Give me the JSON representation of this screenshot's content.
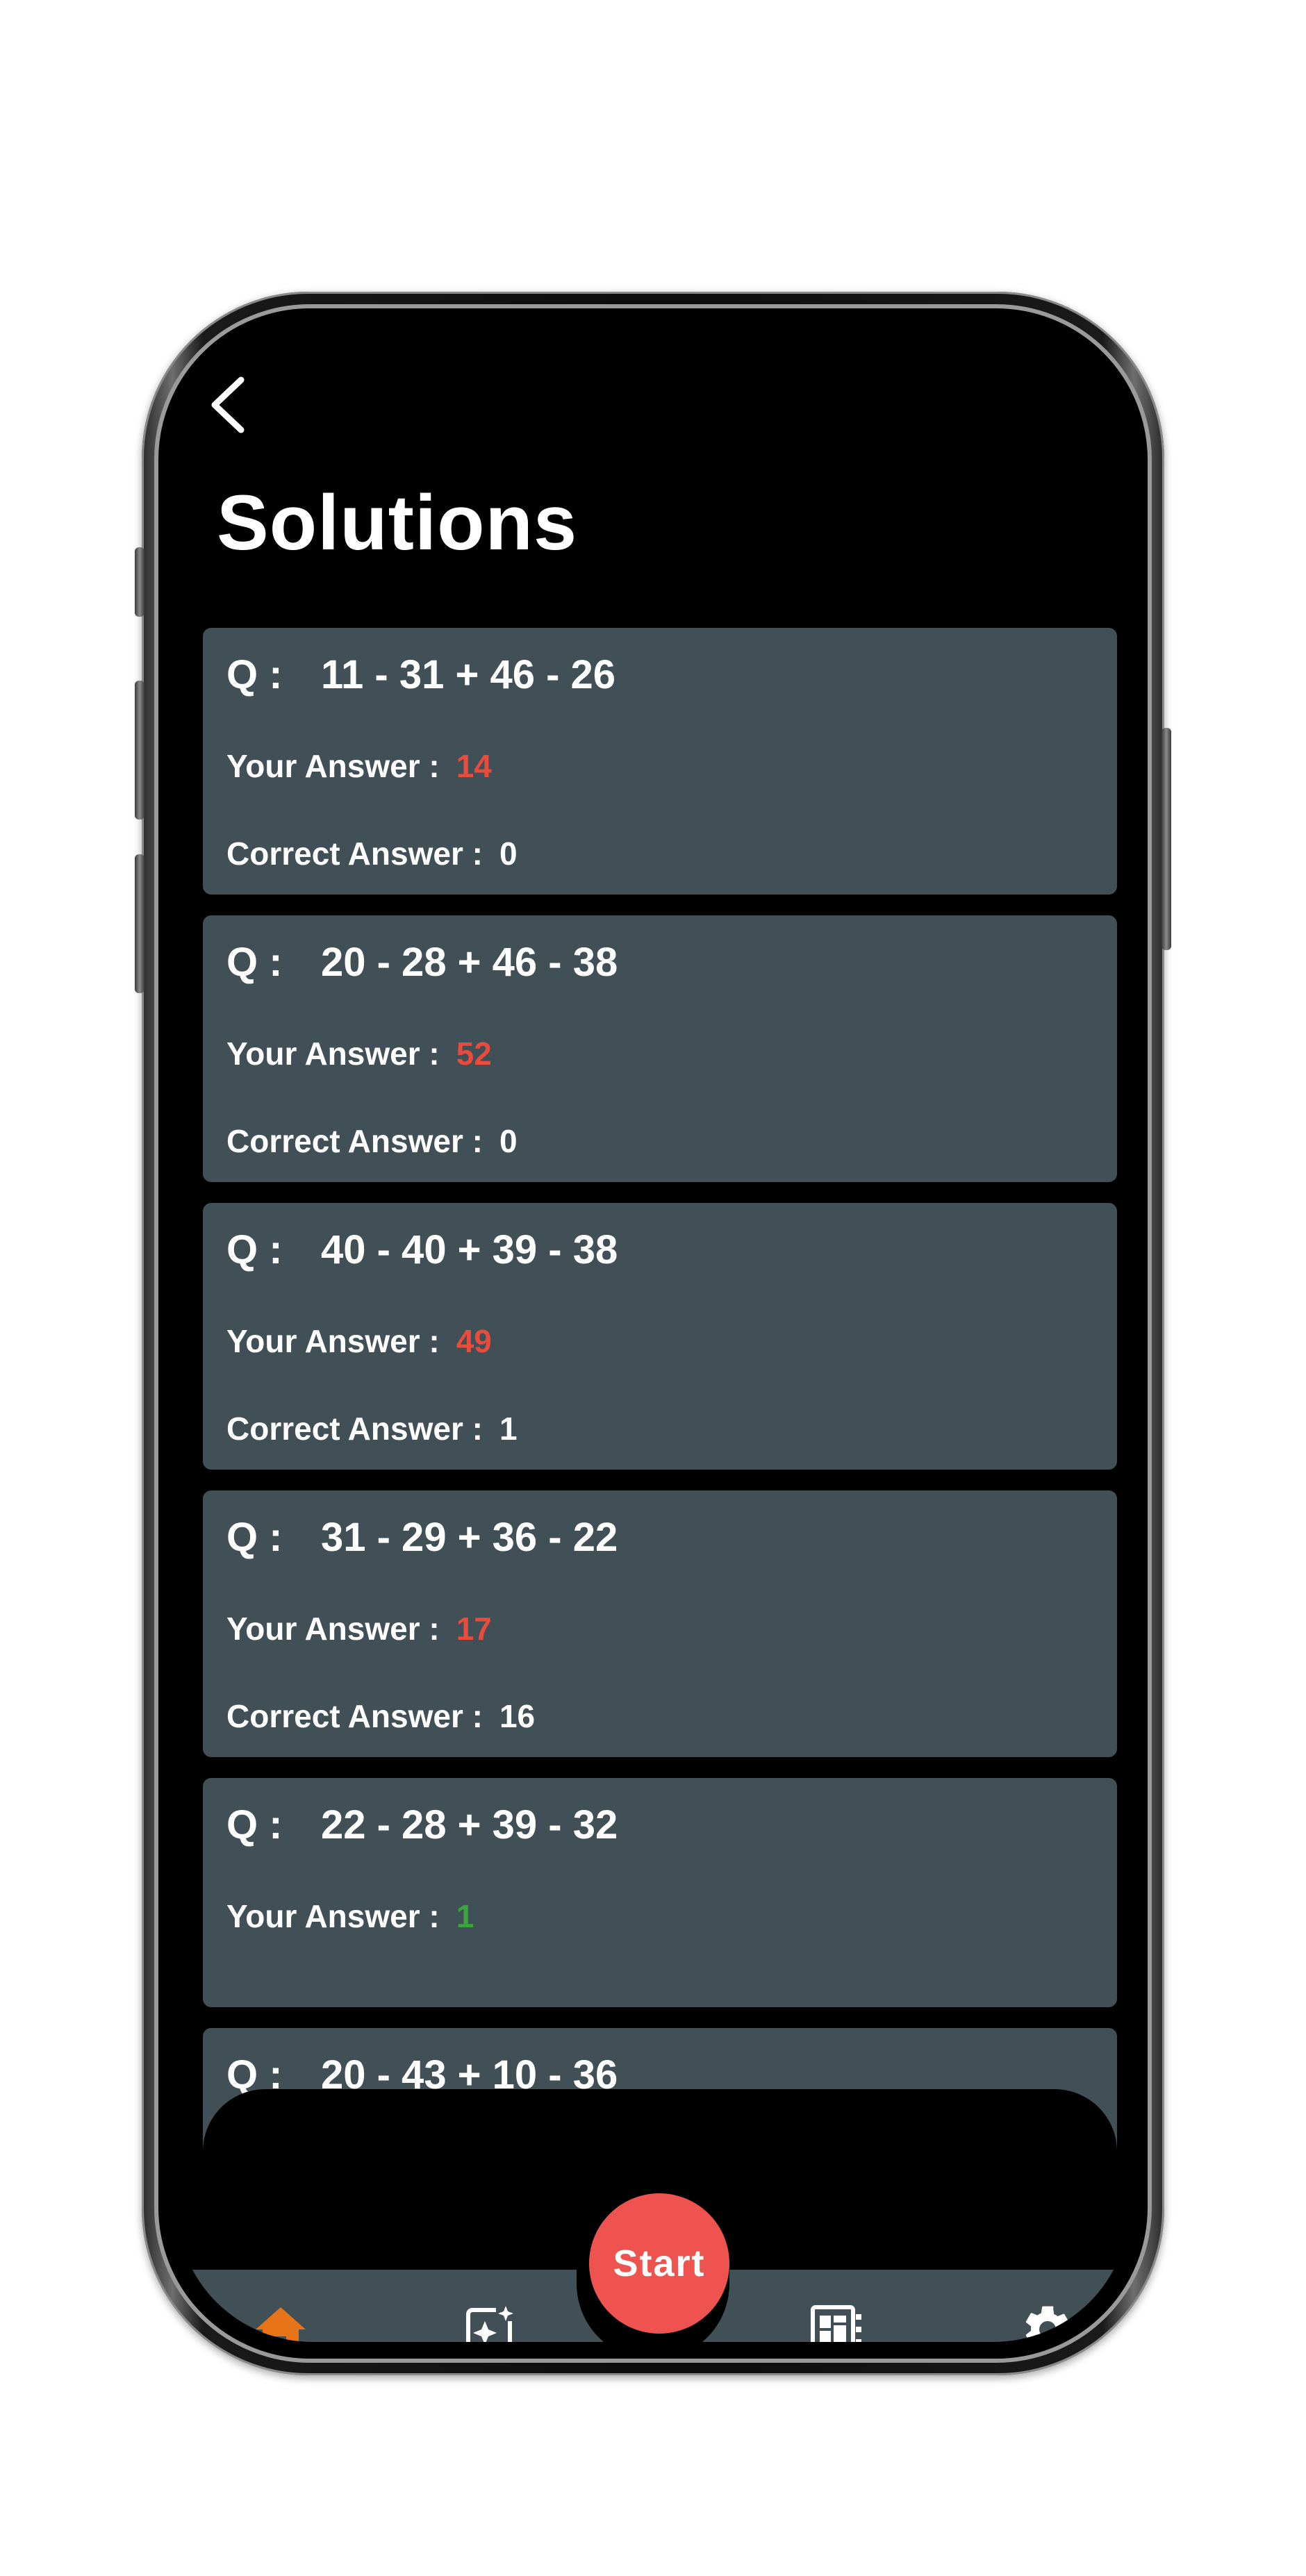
{
  "header": {
    "back_icon": "chevron-left-icon",
    "title": "Solutions"
  },
  "labels": {
    "question_prefix": "Q :",
    "your_answer": "Your Answer :",
    "correct_answer": "Correct Answer :"
  },
  "colors": {
    "card_bg": "#414f56",
    "wrong": "#e74c3c",
    "right": "#3aa63a",
    "accent": "#ef5350",
    "active_nav": "#e8741a"
  },
  "solutions": [
    {
      "question": "11 - 31 + 46 - 26",
      "your_answer": "14",
      "correct_answer": "0",
      "status": "wrong"
    },
    {
      "question": "20 - 28 + 46 - 38",
      "your_answer": "52",
      "correct_answer": "0",
      "status": "wrong"
    },
    {
      "question": "40 - 40 + 39 - 38",
      "your_answer": "49",
      "correct_answer": "1",
      "status": "wrong"
    },
    {
      "question": "31 - 29 + 36 - 22",
      "your_answer": "17",
      "correct_answer": "16",
      "status": "wrong"
    },
    {
      "question": "22 - 28 + 39 - 32",
      "your_answer": "1",
      "correct_answer": "",
      "status": "right"
    },
    {
      "question": "20 - 43 + 10 - 36",
      "your_answer": "",
      "correct_answer": "",
      "status": "partial"
    }
  ],
  "nav": {
    "start_label": "Start",
    "items": [
      {
        "icon": "home-icon",
        "active": true
      },
      {
        "icon": "sparkle-card-icon",
        "active": false
      },
      {
        "icon": "dashboard-icon",
        "active": false
      },
      {
        "icon": "gear-icon",
        "active": false
      }
    ]
  }
}
